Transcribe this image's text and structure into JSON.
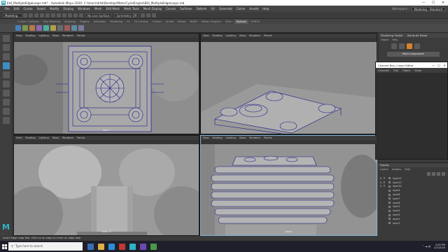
{
  "window": {
    "title": "EHI_MultipleEdgeLoops.mb* - Autodesk Maya 2020: C:\\Users\\drtb\\Desktop\\MotorCycleEngine\\EHI_MultipleEdgeLoops.mb",
    "minimize": "—",
    "maximize": "☐",
    "close": "✕"
  },
  "menubar": {
    "items": [
      "File",
      "Edit",
      "Create",
      "Select",
      "Modify",
      "Display",
      "Windows",
      "Mesh",
      "Edit Mesh",
      "Mesh Tools",
      "Mesh Display",
      "Curves",
      "Surfaces",
      "Deform",
      "UV",
      "Generate",
      "Cache",
      "Arnold",
      "Help"
    ],
    "workspace_label": "Workspace :",
    "workspace_value": "Modeling - Standard"
  },
  "statusline": {
    "mode": "Modeling",
    "live_surface": "No Live Surface",
    "symmetry": "Symmetry: Off"
  },
  "shelf_tabs": [
    "Curves / Surfaces",
    "Poly Modeling",
    "Sculpting",
    "Rigging",
    "Animation",
    "Rendering",
    "FX",
    "FX Caching",
    "Custom",
    "Arnold",
    "Bifrost",
    "MASH",
    "Motion Graphics",
    "XGen",
    "MyIcons",
    "TURTLE"
  ],
  "active_shelf_tab": "MyIcons",
  "viewport_menu": [
    "View",
    "Shading",
    "Lighting",
    "Show",
    "Renderer",
    "Panels"
  ],
  "viewports": {
    "top_left": {
      "camera": "top -Y"
    },
    "top_right": {
      "camera": ""
    },
    "bottom_left": {
      "camera": "front -Z"
    },
    "bottom_right": {
      "camera": "persp"
    }
  },
  "right_panel": {
    "header": [
      "Modelling Toolkit",
      "Attribute Editor"
    ],
    "tabs": [
      "Object",
      "Help"
    ],
    "multi_component": "Multi-Component"
  },
  "channel_box": {
    "title": "Channel Box / Layer Editor",
    "menu": [
      "Channels",
      "Edit",
      "Object",
      "Show"
    ]
  },
  "layer_panel": {
    "tab": "Display",
    "menu": [
      "Layers",
      "Options",
      "Help"
    ],
    "layers": [
      {
        "v": "V",
        "p": "P",
        "name": "layer12"
      },
      {
        "v": "V",
        "p": "P",
        "name": "layer11"
      },
      {
        "v": "V",
        "p": "P",
        "name": "layer10"
      },
      {
        "v": "",
        "p": "",
        "name": "layer9"
      },
      {
        "v": "",
        "p": "",
        "name": "layer8"
      },
      {
        "v": "",
        "p": "",
        "name": "layer7"
      },
      {
        "v": "",
        "p": "",
        "name": "layer6"
      },
      {
        "v": "",
        "p": "",
        "name": "layer5"
      },
      {
        "v": "",
        "p": "",
        "name": "layer4"
      },
      {
        "v": "",
        "p": "",
        "name": "layer3"
      },
      {
        "v": "",
        "p": "",
        "name": "layer2"
      },
      {
        "v": "",
        "p": "",
        "name": "layer1"
      }
    ]
  },
  "helpline": "Insert Edge Loop Tool: Click on an edge to insert an edge loop",
  "mel_label": "MEL",
  "taskbar": {
    "search_placeholder": "Type here to search",
    "time": "4:59 PM",
    "date": "4/7/2020"
  },
  "colors": {
    "wire": "#1a1a8c",
    "accent": "#3d8fc0",
    "maya_teal": "#2fb3c8"
  }
}
